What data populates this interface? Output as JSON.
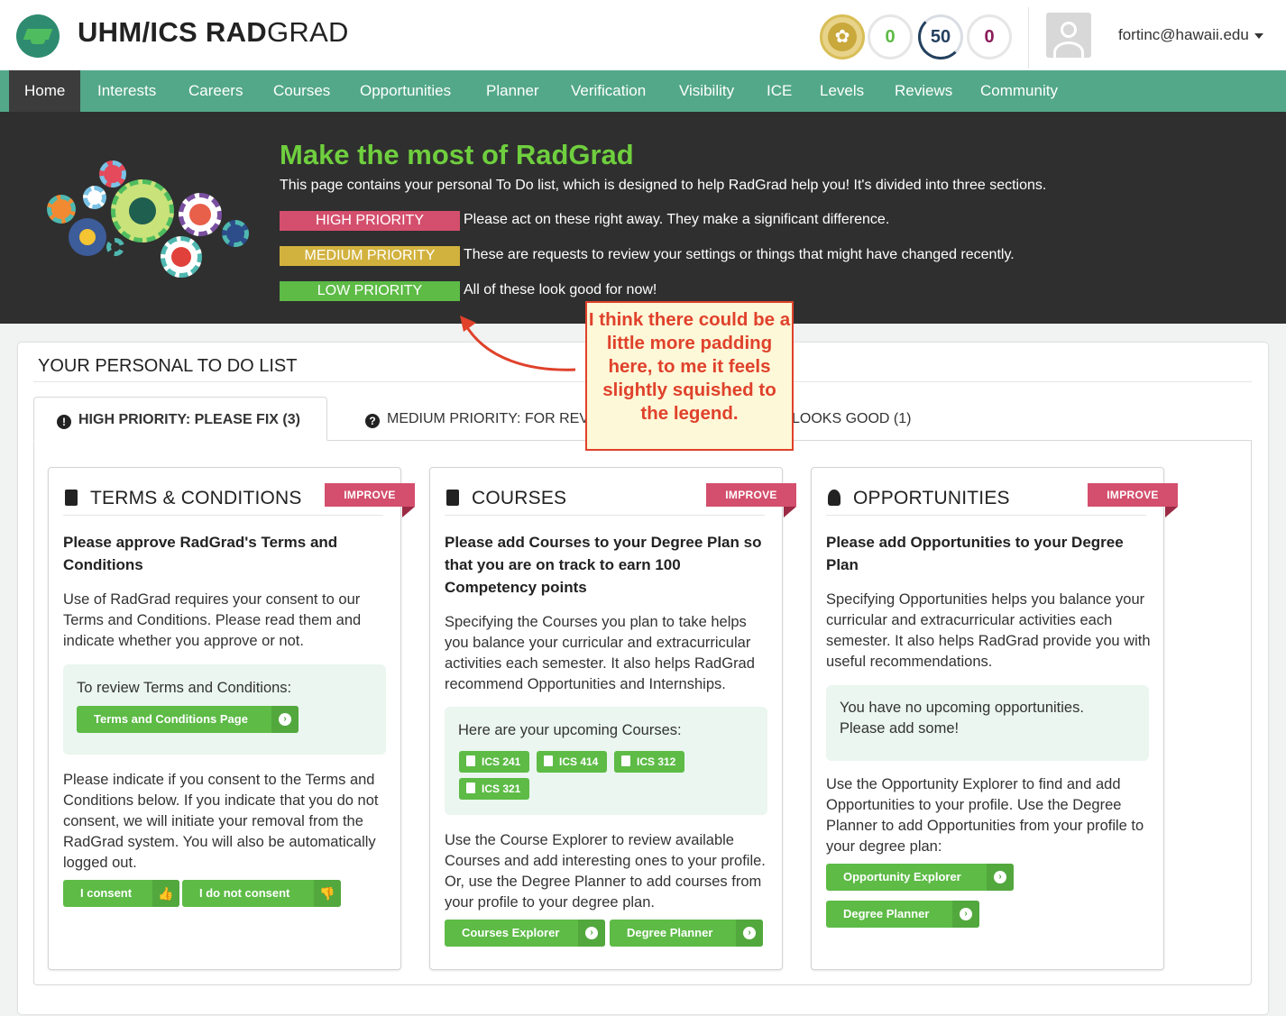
{
  "header": {
    "brand_bold": "UHM/ICS RAD",
    "brand_light": "GRAD",
    "stats": {
      "innovation": "0",
      "competency": "50",
      "experience": "0"
    },
    "user_email": "fortinc@hawaii.edu"
  },
  "nav": {
    "items": [
      "Home",
      "Interests",
      "Careers",
      "Courses",
      "Opportunities",
      "Planner",
      "Verification",
      "Visibility",
      "ICE",
      "Levels",
      "Reviews",
      "Community"
    ],
    "active": "Home"
  },
  "banner": {
    "title": "Make the most of RadGrad",
    "intro": "This page contains your personal To Do list, which is designed to help RadGrad help you! It's divided into three sections.",
    "priorities": [
      {
        "label": "HIGH PRIORITY",
        "desc": "Please act on these right away. They make a significant difference.",
        "color": "#d44f6d"
      },
      {
        "label": "MEDIUM PRIORITY",
        "desc": "These are requests to review your settings or things that might have changed recently.",
        "color": "#d2b23e"
      },
      {
        "label": "LOW PRIORITY",
        "desc": "All of these look good for now!",
        "color": "#5dbb46"
      }
    ]
  },
  "todo": {
    "title": "YOUR PERSONAL TO DO LIST",
    "tabs": [
      {
        "label": "HIGH PRIORITY: PLEASE FIX (3)"
      },
      {
        "label": "MEDIUM PRIORITY: FOR REVIEW"
      },
      {
        "label": "LOOKS GOOD (1)"
      }
    ],
    "ribbon": "IMPROVE",
    "cards": {
      "terms": {
        "title": "TERMS & CONDITIONS",
        "heading": "Please approve RadGrad's Terms and Conditions",
        "p1": "Use of RadGrad requires your consent to our Terms and Conditions. Please read them and indicate whether you approve or not.",
        "box_text": "To review Terms and Conditions:",
        "box_button": "Terms and Conditions Page",
        "p2": "Please indicate if you consent to the Terms and Conditions below. If you indicate that you do not consent, we will initiate your removal from the RadGrad system. You will also be automatically logged out.",
        "consent": "I consent",
        "no_consent": "I do not consent"
      },
      "courses": {
        "title": "COURSES",
        "heading": "Please add Courses to your Degree Plan so that you are on track to earn 100 Competency points",
        "p1": "Specifying the Courses you plan to take helps you balance your curricular and extracurricular activities each semester. It also helps RadGrad recommend Opportunities and Internships.",
        "box_text": "Here are your upcoming Courses:",
        "chips": [
          "ICS 241",
          "ICS 414",
          "ICS 312",
          "ICS 321"
        ],
        "p2": "Use the Course Explorer to review available Courses and add interesting ones to your profile. Or, use the Degree Planner to add courses from your profile to your degree plan.",
        "btn1": "Courses Explorer",
        "btn2": "Degree Planner"
      },
      "opps": {
        "title": "OPPORTUNITIES",
        "heading": "Please add Opportunities to your Degree Plan",
        "p1": "Specifying Opportunities helps you balance your curricular and extracurricular activities each semester. It also helps RadGrad provide you with useful recommendations.",
        "box_text": "You have no upcoming opportunities. Please add some!",
        "p2": "Use the Opportunity Explorer to find and add Opportunities to your profile. Use the Degree Planner to add Opportunities from your profile to your degree plan:",
        "btn1": "Opportunity Explorer",
        "btn2": "Degree Planner"
      }
    }
  },
  "annotation": {
    "text": "I think there could be a little more padding here, to me it feels slightly squished to the legend."
  }
}
